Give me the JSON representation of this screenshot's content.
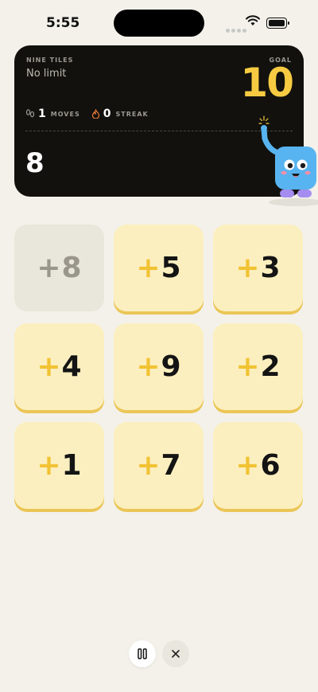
{
  "status_bar": {
    "time": "5:55"
  },
  "header": {
    "mode_label": "NINE TILES",
    "limit_text": "No limit",
    "goal_label": "GOAL",
    "goal_value": "10",
    "moves_count": "1",
    "moves_label": "MOVES",
    "streak_count": "0",
    "streak_label": "STREAK",
    "current_total": "8"
  },
  "tiles": [
    {
      "sign": "+",
      "value": "8",
      "used": true
    },
    {
      "sign": "+",
      "value": "5",
      "used": false
    },
    {
      "sign": "+",
      "value": "3",
      "used": false
    },
    {
      "sign": "+",
      "value": "4",
      "used": false
    },
    {
      "sign": "+",
      "value": "9",
      "used": false
    },
    {
      "sign": "+",
      "value": "2",
      "used": false
    },
    {
      "sign": "+",
      "value": "1",
      "used": false
    },
    {
      "sign": "+",
      "value": "7",
      "used": false
    },
    {
      "sign": "+",
      "value": "6",
      "used": false
    }
  ],
  "colors": {
    "background": "#F3F1EA",
    "card": "#12110D",
    "accent_yellow": "#F6CB42",
    "tile_fill": "#FCEFBF",
    "tile_used": "#E9E6DC",
    "mascot_blue": "#58B4F0"
  },
  "icons": {
    "moves": "footprints-icon",
    "streak": "flame-icon",
    "pause": "pause-icon",
    "close": "close-icon"
  }
}
